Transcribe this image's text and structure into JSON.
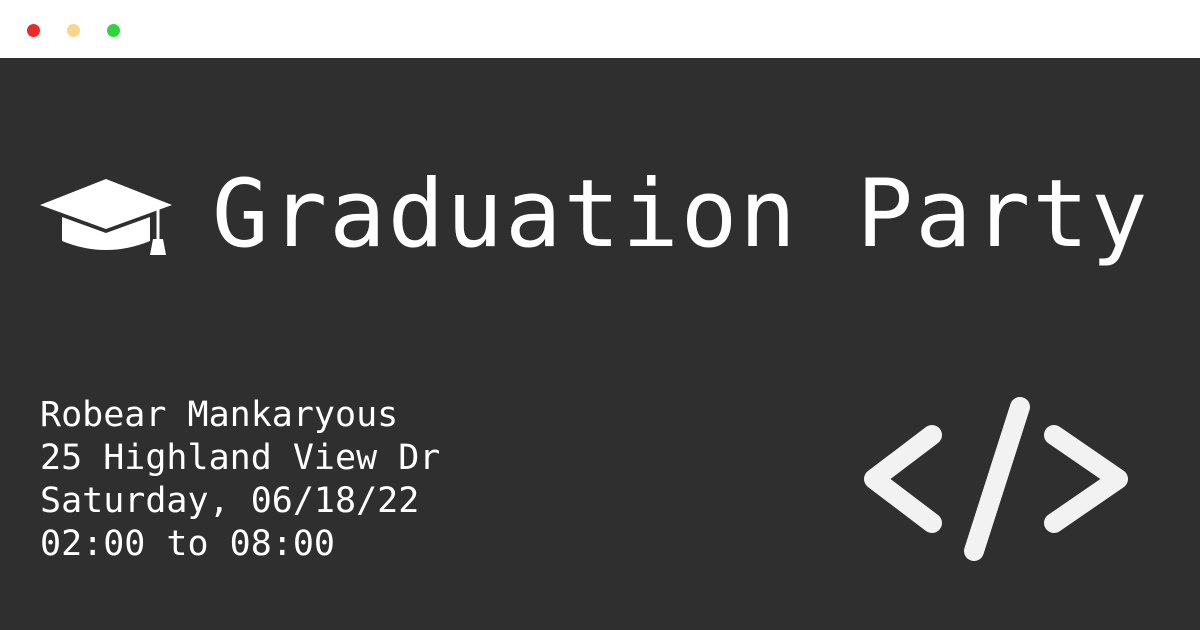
{
  "window": {
    "controls": [
      {
        "name": "close",
        "color": "#ed2a2a"
      },
      {
        "name": "minimize",
        "color": "#fcd48a"
      },
      {
        "name": "maximize",
        "color": "#2ed43a"
      }
    ]
  },
  "colors": {
    "background": "#2f2f2f",
    "text": "#ffffff",
    "titlebar": "#ffffff",
    "icon": "#f2f2f2"
  },
  "header": {
    "icon": "graduation-cap-icon",
    "title": "Graduation Party"
  },
  "details": {
    "name": "Robear Mankaryous",
    "address": "25 Highland View Dr",
    "date": "Saturday, 06/18/22",
    "time": "02:00 to 08:00"
  },
  "decoration": {
    "icon": "code-brackets-icon"
  }
}
